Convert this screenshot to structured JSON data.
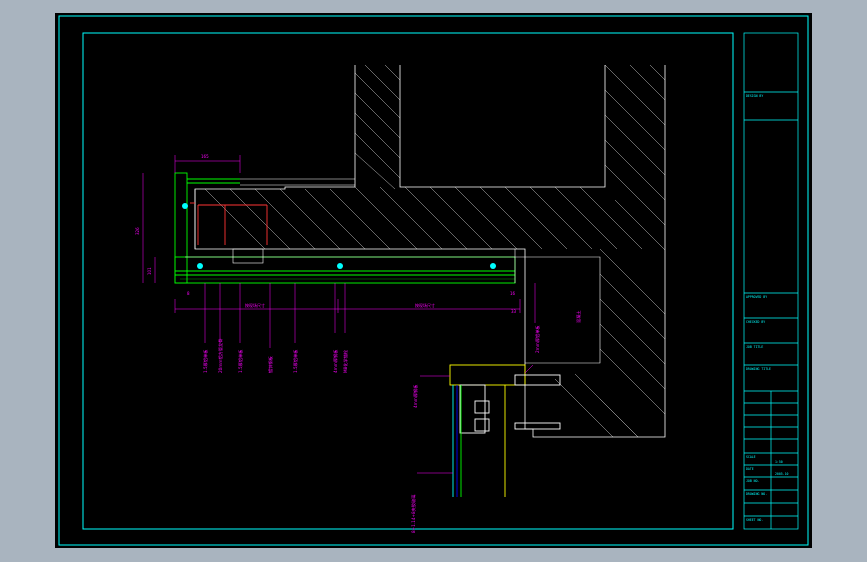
{
  "title_block": {
    "design_by": "DESIGN BY",
    "approved_row": "APPROVED BY",
    "checked": "CHECKED BY",
    "job_title": "JOB TITLE",
    "drawing_title": "DRAWING TITLE",
    "scale": "SCALE",
    "scale_value": "1:50",
    "date": "DATE",
    "date_value": "2005.10",
    "job_no": "JOB NO.",
    "drawing_no": "DRAWING NO.",
    "sheet_no": "SHEET NO."
  },
  "dimensions": {
    "top_width": "165",
    "left_height": "326",
    "left_small": "101",
    "bottom_small_left": "8",
    "bottom_small_right": "16",
    "right_small": "33",
    "span_left": "按现场尺寸",
    "span_right": "按现场尺寸"
  },
  "notes": {
    "n1": "1.5厚铝单板",
    "n2": "20mm铝方管龙骨",
    "n3": "1.5厚铝单板",
    "n4": "镀锌钢板",
    "n5": "1.5厚铝单板",
    "n6": "4mm厚钢板",
    "n7": "M8化学锚栓",
    "n8": "2mm厚铝单板",
    "n9": "4mm厚钢板",
    "n10": "8+1.14+8夹胶玻璃",
    "n11": "混凝土"
  }
}
